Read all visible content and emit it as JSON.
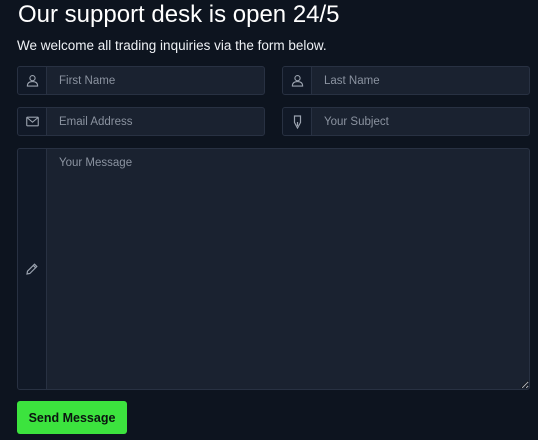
{
  "header": {
    "title": "Our support desk is open 24/5",
    "subtitle": "We welcome all trading inquiries via the form below."
  },
  "form": {
    "first_name": {
      "placeholder": "First Name",
      "value": "",
      "icon": "user-icon"
    },
    "last_name": {
      "placeholder": "Last Name",
      "value": "",
      "icon": "user-icon"
    },
    "email": {
      "placeholder": "Email Address",
      "value": "",
      "icon": "envelope-icon"
    },
    "subject": {
      "placeholder": "Your Subject",
      "value": "",
      "icon": "pen-nib-icon"
    },
    "message": {
      "placeholder": "Your Message",
      "value": "",
      "icon": "pencil-icon"
    },
    "submit_label": "Send Message"
  },
  "colors": {
    "background": "#0d141f",
    "field_bg": "#1a2230",
    "addon_bg": "#111927",
    "border": "#283142",
    "accent": "#3ce33e"
  }
}
